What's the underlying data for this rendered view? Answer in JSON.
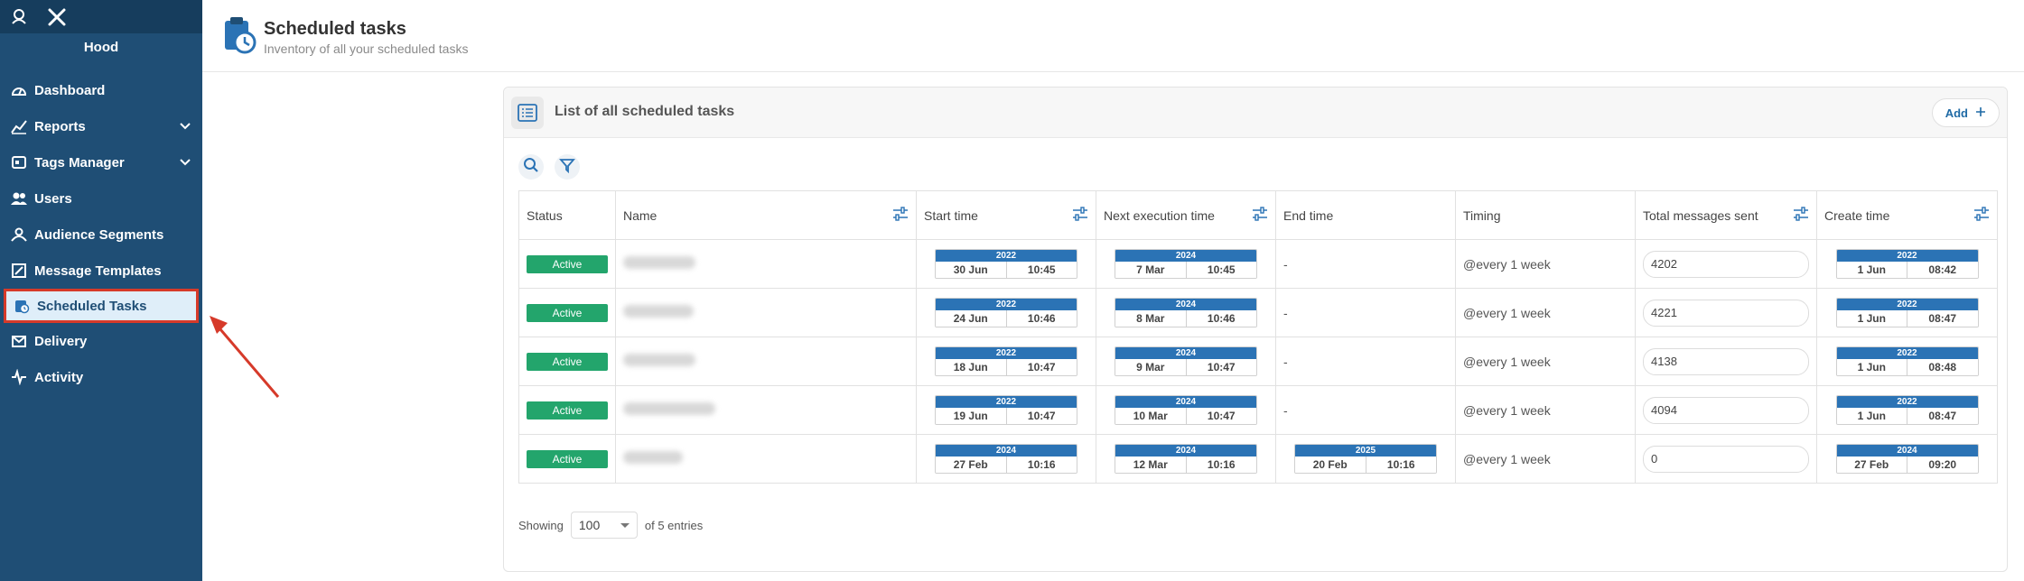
{
  "sidebar": {
    "org_name": "Hood",
    "items": [
      {
        "label": "Dashboard",
        "icon": "dashboard-icon"
      },
      {
        "label": "Reports",
        "icon": "reports-icon",
        "expandable": true
      },
      {
        "label": "Tags Manager",
        "icon": "tags-icon",
        "expandable": true
      },
      {
        "label": "Users",
        "icon": "users-icon"
      },
      {
        "label": "Audience Segments",
        "icon": "audience-icon"
      },
      {
        "label": "Message Templates",
        "icon": "template-icon"
      },
      {
        "label": "Scheduled Tasks",
        "icon": "scheduled-tasks-icon",
        "active": true
      },
      {
        "label": "Delivery",
        "icon": "delivery-icon"
      },
      {
        "label": "Activity",
        "icon": "activity-icon"
      }
    ]
  },
  "header": {
    "title": "Scheduled tasks",
    "subtitle": "Inventory of all your scheduled tasks"
  },
  "panel": {
    "title": "List of all scheduled tasks",
    "add_label": "Add"
  },
  "table": {
    "columns": [
      "Status",
      "Name",
      "Start time",
      "Next execution time",
      "End time",
      "Timing",
      "Total messages sent",
      "Create time"
    ],
    "rows": [
      {
        "status": "Active",
        "start": {
          "year": "2022",
          "date": "30 Jun",
          "time": "10:45"
        },
        "next": {
          "year": "2024",
          "date": "7 Mar",
          "time": "10:45"
        },
        "end": "-",
        "timing": "@every 1 week",
        "total": "4202",
        "create": {
          "year": "2022",
          "date": "1 Jun",
          "time": "08:42"
        }
      },
      {
        "status": "Active",
        "start": {
          "year": "2022",
          "date": "24 Jun",
          "time": "10:46"
        },
        "next": {
          "year": "2024",
          "date": "8 Mar",
          "time": "10:46"
        },
        "end": "-",
        "timing": "@every 1 week",
        "total": "4221",
        "create": {
          "year": "2022",
          "date": "1 Jun",
          "time": "08:47"
        }
      },
      {
        "status": "Active",
        "start": {
          "year": "2022",
          "date": "18 Jun",
          "time": "10:47"
        },
        "next": {
          "year": "2024",
          "date": "9 Mar",
          "time": "10:47"
        },
        "end": "-",
        "timing": "@every 1 week",
        "total": "4138",
        "create": {
          "year": "2022",
          "date": "1 Jun",
          "time": "08:48"
        }
      },
      {
        "status": "Active",
        "start": {
          "year": "2022",
          "date": "19 Jun",
          "time": "10:47"
        },
        "next": {
          "year": "2024",
          "date": "10 Mar",
          "time": "10:47"
        },
        "end": "-",
        "timing": "@every 1 week",
        "total": "4094",
        "create": {
          "year": "2022",
          "date": "1 Jun",
          "time": "08:47"
        }
      },
      {
        "status": "Active",
        "start": {
          "year": "2024",
          "date": "27 Feb",
          "time": "10:16"
        },
        "next": {
          "year": "2024",
          "date": "12 Mar",
          "time": "10:16"
        },
        "end": {
          "year": "2025",
          "date": "20 Feb",
          "time": "10:16"
        },
        "timing": "@every 1 week",
        "total": "0",
        "create": {
          "year": "2024",
          "date": "27 Feb",
          "time": "09:20"
        }
      }
    ]
  },
  "footer": {
    "showing_label": "Showing",
    "page_size": "100",
    "entries_label": "of 5 entries"
  },
  "colors": {
    "sidebar": "#1f4e75",
    "accent": "#2b73b5",
    "status_active": "#23a56c",
    "highlight": "#d63a2a"
  }
}
